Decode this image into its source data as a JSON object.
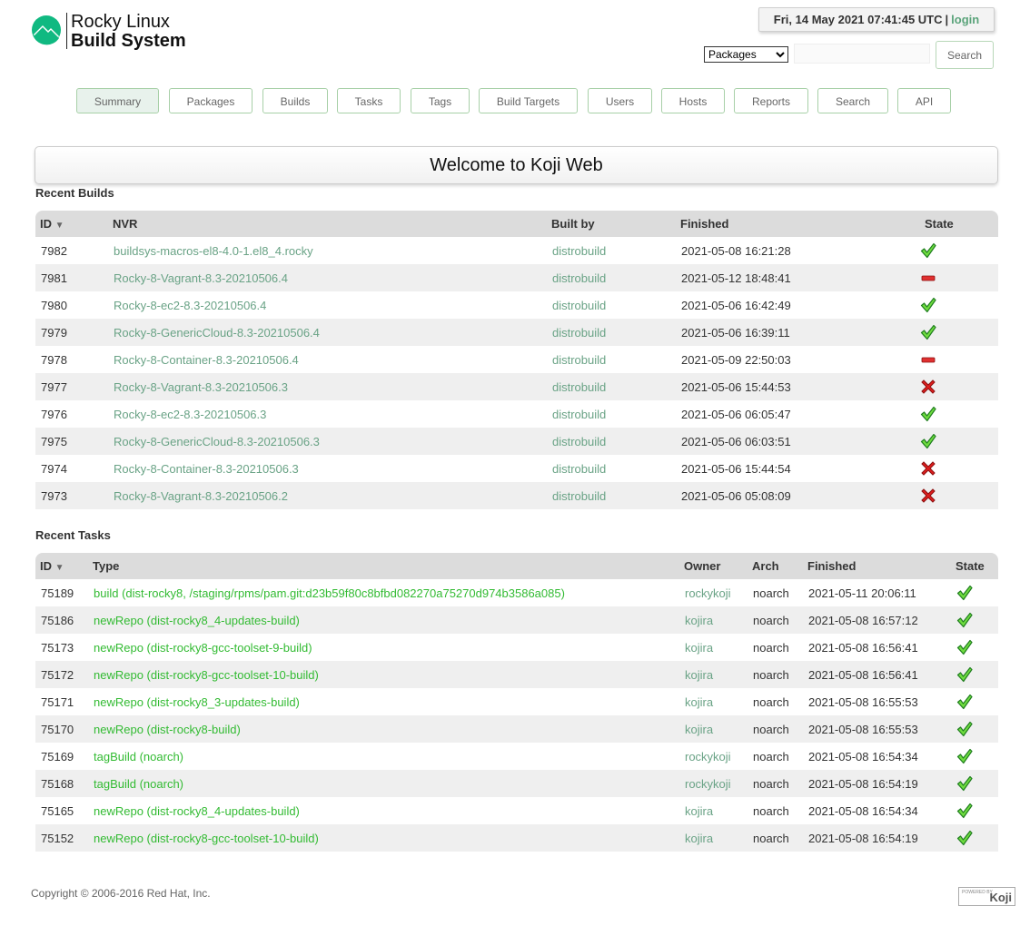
{
  "header": {
    "logo_line1": "Rocky Linux",
    "logo_line2": "Build System",
    "brand_color": "#10b981",
    "datetime": "Fri, 14 May 2021 07:41:45 UTC",
    "separator": "|",
    "login_label": "login"
  },
  "search": {
    "selected_option": "Packages",
    "input_value": "",
    "button_label": "Search"
  },
  "nav": {
    "tabs": [
      {
        "label": "Summary",
        "active": true
      },
      {
        "label": "Packages"
      },
      {
        "label": "Builds"
      },
      {
        "label": "Tasks"
      },
      {
        "label": "Tags"
      },
      {
        "label": "Build Targets"
      },
      {
        "label": "Users"
      },
      {
        "label": "Hosts"
      },
      {
        "label": "Reports"
      },
      {
        "label": "Search"
      },
      {
        "label": "API"
      }
    ]
  },
  "welcome": "Welcome to Koji Web",
  "recent_builds": {
    "title": "Recent Builds",
    "columns": {
      "id": "ID",
      "nvr": "NVR",
      "built_by": "Built by",
      "finished": "Finished",
      "state": "State"
    },
    "rows": [
      {
        "id": "7982",
        "nvr": "buildsys-macros-el8-4.0-1.el8_4.rocky",
        "built_by": "distrobuild",
        "finished": "2021-05-08 16:21:28",
        "state": "complete"
      },
      {
        "id": "7981",
        "nvr": "Rocky-8-Vagrant-8.3-20210506.4",
        "built_by": "distrobuild",
        "finished": "2021-05-12 18:48:41",
        "state": "canceled"
      },
      {
        "id": "7980",
        "nvr": "Rocky-8-ec2-8.3-20210506.4",
        "built_by": "distrobuild",
        "finished": "2021-05-06 16:42:49",
        "state": "complete"
      },
      {
        "id": "7979",
        "nvr": "Rocky-8-GenericCloud-8.3-20210506.4",
        "built_by": "distrobuild",
        "finished": "2021-05-06 16:39:11",
        "state": "complete"
      },
      {
        "id": "7978",
        "nvr": "Rocky-8-Container-8.3-20210506.4",
        "built_by": "distrobuild",
        "finished": "2021-05-09 22:50:03",
        "state": "canceled"
      },
      {
        "id": "7977",
        "nvr": "Rocky-8-Vagrant-8.3-20210506.3",
        "built_by": "distrobuild",
        "finished": "2021-05-06 15:44:53",
        "state": "failed"
      },
      {
        "id": "7976",
        "nvr": "Rocky-8-ec2-8.3-20210506.3",
        "built_by": "distrobuild",
        "finished": "2021-05-06 06:05:47",
        "state": "complete"
      },
      {
        "id": "7975",
        "nvr": "Rocky-8-GenericCloud-8.3-20210506.3",
        "built_by": "distrobuild",
        "finished": "2021-05-06 06:03:51",
        "state": "complete"
      },
      {
        "id": "7974",
        "nvr": "Rocky-8-Container-8.3-20210506.3",
        "built_by": "distrobuild",
        "finished": "2021-05-06 15:44:54",
        "state": "failed"
      },
      {
        "id": "7973",
        "nvr": "Rocky-8-Vagrant-8.3-20210506.2",
        "built_by": "distrobuild",
        "finished": "2021-05-06 05:08:09",
        "state": "failed"
      }
    ]
  },
  "recent_tasks": {
    "title": "Recent Tasks",
    "columns": {
      "id": "ID",
      "type": "Type",
      "owner": "Owner",
      "arch": "Arch",
      "finished": "Finished",
      "state": "State"
    },
    "rows": [
      {
        "id": "75189",
        "type": "build (dist-rocky8, /staging/rpms/pam.git:d23b59f80c8bfbd082270a75270d974b3586a085)",
        "owner": "rockykoji",
        "arch": "noarch",
        "finished": "2021-05-11 20:06:11",
        "state": "complete"
      },
      {
        "id": "75186",
        "type": "newRepo (dist-rocky8_4-updates-build)",
        "owner": "kojira",
        "arch": "noarch",
        "finished": "2021-05-08 16:57:12",
        "state": "complete"
      },
      {
        "id": "75173",
        "type": "newRepo (dist-rocky8-gcc-toolset-9-build)",
        "owner": "kojira",
        "arch": "noarch",
        "finished": "2021-05-08 16:56:41",
        "state": "complete"
      },
      {
        "id": "75172",
        "type": "newRepo (dist-rocky8-gcc-toolset-10-build)",
        "owner": "kojira",
        "arch": "noarch",
        "finished": "2021-05-08 16:56:41",
        "state": "complete"
      },
      {
        "id": "75171",
        "type": "newRepo (dist-rocky8_3-updates-build)",
        "owner": "kojira",
        "arch": "noarch",
        "finished": "2021-05-08 16:55:53",
        "state": "complete"
      },
      {
        "id": "75170",
        "type": "newRepo (dist-rocky8-build)",
        "owner": "kojira",
        "arch": "noarch",
        "finished": "2021-05-08 16:55:53",
        "state": "complete"
      },
      {
        "id": "75169",
        "type": "tagBuild (noarch)",
        "owner": "rockykoji",
        "arch": "noarch",
        "finished": "2021-05-08 16:54:34",
        "state": "complete"
      },
      {
        "id": "75168",
        "type": "tagBuild (noarch)",
        "owner": "rockykoji",
        "arch": "noarch",
        "finished": "2021-05-08 16:54:19",
        "state": "complete"
      },
      {
        "id": "75165",
        "type": "newRepo (dist-rocky8_4-updates-build)",
        "owner": "kojira",
        "arch": "noarch",
        "finished": "2021-05-08 16:54:34",
        "state": "complete"
      },
      {
        "id": "75152",
        "type": "newRepo (dist-rocky8-gcc-toolset-10-build)",
        "owner": "kojira",
        "arch": "noarch",
        "finished": "2021-05-08 16:54:19",
        "state": "complete"
      }
    ]
  },
  "footer": {
    "copyright": "Copyright © 2006-2016 Red Hat, Inc.",
    "powered_by": "POWERED BY",
    "powered_logo": "Koji"
  }
}
